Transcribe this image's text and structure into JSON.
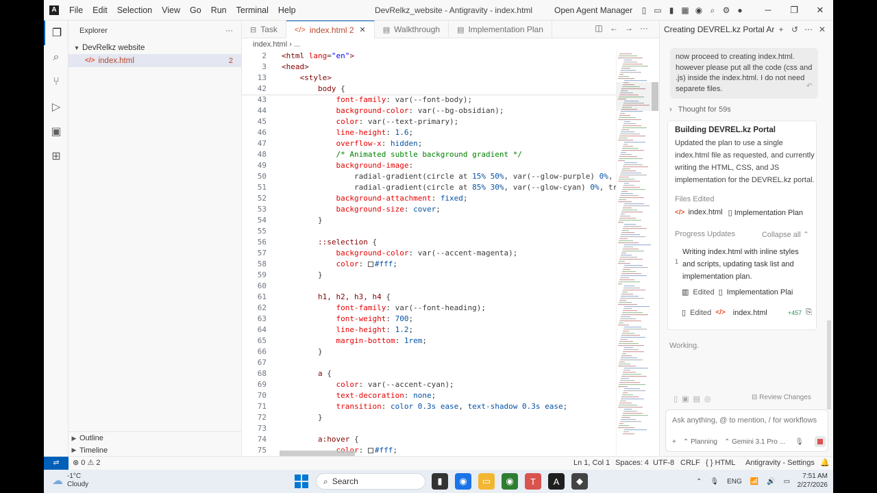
{
  "titlebar": {
    "menus": [
      "File",
      "Edit",
      "Selection",
      "View",
      "Go",
      "Run",
      "Terminal",
      "Help"
    ],
    "title": "DevRelkz_website - Antigravity - index.html",
    "agent_manager": "Open Agent Manager"
  },
  "sidebar": {
    "header": "Explorer",
    "folder": "DevRelkz website",
    "file_name": "index.html",
    "file_badge": "2",
    "outline": "Outline",
    "timeline": "Timeline"
  },
  "tabs": [
    {
      "label": "Task",
      "icon": "list-icon"
    },
    {
      "label": "index.html 2",
      "icon": "html-icon",
      "active": true
    },
    {
      "label": "Walkthrough",
      "icon": "doc-icon"
    },
    {
      "label": "Implementation Plan",
      "icon": "doc-icon"
    }
  ],
  "breadcrumb": {
    "file": "index.html",
    "rest": "..."
  },
  "editor": {
    "sticky": [
      {
        "n": "2",
        "segs": [
          [
            "c-tag",
            "<html "
          ],
          [
            "c-attr",
            "lang"
          ],
          [
            "c-txt",
            "="
          ],
          [
            "c-str",
            "\"en\""
          ],
          [
            "c-tag",
            ">"
          ]
        ]
      },
      {
        "n": "3",
        "segs": [
          [
            "c-tag",
            "<head>"
          ]
        ]
      },
      {
        "n": "13",
        "segs": [
          [
            "c-txt",
            "    "
          ],
          [
            "c-tag",
            "<style>"
          ]
        ]
      },
      {
        "n": "42",
        "segs": [
          [
            "c-txt",
            "        "
          ],
          [
            "c-sel",
            "body"
          ],
          [
            "c-txt",
            " {"
          ]
        ]
      }
    ],
    "lines": [
      {
        "n": "43",
        "segs": [
          [
            "c-txt",
            "            "
          ],
          [
            "c-prop",
            "font-family"
          ],
          [
            "c-txt",
            ": var(--font-body);"
          ]
        ]
      },
      {
        "n": "44",
        "segs": [
          [
            "c-txt",
            "            "
          ],
          [
            "c-prop",
            "background-color"
          ],
          [
            "c-txt",
            ": var(--bg-obsidian);"
          ]
        ]
      },
      {
        "n": "45",
        "segs": [
          [
            "c-txt",
            "            "
          ],
          [
            "c-prop",
            "color"
          ],
          [
            "c-txt",
            ": var(--text-primary);"
          ]
        ]
      },
      {
        "n": "46",
        "segs": [
          [
            "c-txt",
            "            "
          ],
          [
            "c-prop",
            "line-height"
          ],
          [
            "c-txt",
            ": "
          ],
          [
            "c-val",
            "1.6"
          ],
          [
            "c-txt",
            ";"
          ]
        ]
      },
      {
        "n": "47",
        "segs": [
          [
            "c-txt",
            "            "
          ],
          [
            "c-prop",
            "overflow-x"
          ],
          [
            "c-txt",
            ": "
          ],
          [
            "c-val",
            "hidden"
          ],
          [
            "c-txt",
            ";"
          ]
        ]
      },
      {
        "n": "48",
        "segs": [
          [
            "c-txt",
            "            "
          ],
          [
            "c-cmt",
            "/* Animated subtle background gradient */"
          ]
        ]
      },
      {
        "n": "49",
        "segs": [
          [
            "c-txt",
            "            "
          ],
          [
            "c-prop",
            "background-image"
          ],
          [
            "c-txt",
            ":"
          ]
        ]
      },
      {
        "n": "50",
        "segs": [
          [
            "c-txt",
            "                "
          ],
          [
            "c-txt",
            "radial-gradient(circle at "
          ],
          [
            "c-val",
            "15% 50%"
          ],
          [
            "c-txt",
            ", var(--glow-purple) "
          ],
          [
            "c-val",
            "0%"
          ],
          [
            "c-txt",
            ", t"
          ]
        ]
      },
      {
        "n": "51",
        "segs": [
          [
            "c-txt",
            "                "
          ],
          [
            "c-txt",
            "radial-gradient(circle at "
          ],
          [
            "c-val",
            "85% 30%"
          ],
          [
            "c-txt",
            ", var(--glow-cyan) "
          ],
          [
            "c-val",
            "0%"
          ],
          [
            "c-txt",
            ", tra"
          ]
        ]
      },
      {
        "n": "52",
        "segs": [
          [
            "c-txt",
            "            "
          ],
          [
            "c-prop",
            "background-attachment"
          ],
          [
            "c-txt",
            ": "
          ],
          [
            "c-val",
            "fixed"
          ],
          [
            "c-txt",
            ";"
          ]
        ]
      },
      {
        "n": "53",
        "segs": [
          [
            "c-txt",
            "            "
          ],
          [
            "c-prop",
            "background-size"
          ],
          [
            "c-txt",
            ": "
          ],
          [
            "c-val",
            "cover"
          ],
          [
            "c-txt",
            ";"
          ]
        ]
      },
      {
        "n": "54",
        "segs": [
          [
            "c-txt",
            "        }"
          ]
        ]
      },
      {
        "n": "55",
        "segs": []
      },
      {
        "n": "56",
        "segs": [
          [
            "c-txt",
            "        "
          ],
          [
            "c-sel",
            "::selection"
          ],
          [
            "c-txt",
            " {"
          ]
        ]
      },
      {
        "n": "57",
        "segs": [
          [
            "c-txt",
            "            "
          ],
          [
            "c-prop",
            "background-color"
          ],
          [
            "c-txt",
            ": var(--accent-magenta);"
          ]
        ]
      },
      {
        "n": "58",
        "segs": [
          [
            "c-txt",
            "            "
          ],
          [
            "c-prop",
            "color"
          ],
          [
            "c-txt",
            ": "
          ],
          [
            "box",
            ""
          ],
          [
            "c-val",
            "#fff"
          ],
          [
            "c-txt",
            ";"
          ]
        ]
      },
      {
        "n": "59",
        "segs": [
          [
            "c-txt",
            "        }"
          ]
        ]
      },
      {
        "n": "60",
        "segs": []
      },
      {
        "n": "61",
        "segs": [
          [
            "c-txt",
            "        "
          ],
          [
            "c-sel",
            "h1, h2, h3, h4"
          ],
          [
            "c-txt",
            " {"
          ]
        ]
      },
      {
        "n": "62",
        "segs": [
          [
            "c-txt",
            "            "
          ],
          [
            "c-prop",
            "font-family"
          ],
          [
            "c-txt",
            ": var(--font-heading);"
          ]
        ]
      },
      {
        "n": "63",
        "segs": [
          [
            "c-txt",
            "            "
          ],
          [
            "c-prop",
            "font-weight"
          ],
          [
            "c-txt",
            ": "
          ],
          [
            "c-val",
            "700"
          ],
          [
            "c-txt",
            ";"
          ]
        ]
      },
      {
        "n": "64",
        "segs": [
          [
            "c-txt",
            "            "
          ],
          [
            "c-prop",
            "line-height"
          ],
          [
            "c-txt",
            ": "
          ],
          [
            "c-val",
            "1.2"
          ],
          [
            "c-txt",
            ";"
          ]
        ]
      },
      {
        "n": "65",
        "segs": [
          [
            "c-txt",
            "            "
          ],
          [
            "c-prop",
            "margin-bottom"
          ],
          [
            "c-txt",
            ": "
          ],
          [
            "c-val",
            "1rem"
          ],
          [
            "c-txt",
            ";"
          ]
        ]
      },
      {
        "n": "66",
        "segs": [
          [
            "c-txt",
            "        }"
          ]
        ]
      },
      {
        "n": "67",
        "segs": []
      },
      {
        "n": "68",
        "segs": [
          [
            "c-txt",
            "        "
          ],
          [
            "c-sel",
            "a"
          ],
          [
            "c-txt",
            " {"
          ]
        ]
      },
      {
        "n": "69",
        "segs": [
          [
            "c-txt",
            "            "
          ],
          [
            "c-prop",
            "color"
          ],
          [
            "c-txt",
            ": var(--accent-cyan);"
          ]
        ]
      },
      {
        "n": "70",
        "segs": [
          [
            "c-txt",
            "            "
          ],
          [
            "c-prop",
            "text-decoration"
          ],
          [
            "c-txt",
            ": "
          ],
          [
            "c-val",
            "none"
          ],
          [
            "c-txt",
            ";"
          ]
        ]
      },
      {
        "n": "71",
        "segs": [
          [
            "c-txt",
            "            "
          ],
          [
            "c-prop",
            "transition"
          ],
          [
            "c-txt",
            ": "
          ],
          [
            "c-val",
            "color 0.3s ease"
          ],
          [
            "c-txt",
            ", "
          ],
          [
            "c-val",
            "text-shadow 0.3s ease"
          ],
          [
            "c-txt",
            ";"
          ]
        ]
      },
      {
        "n": "72",
        "segs": [
          [
            "c-txt",
            "        }"
          ]
        ]
      },
      {
        "n": "73",
        "segs": []
      },
      {
        "n": "74",
        "segs": [
          [
            "c-txt",
            "        "
          ],
          [
            "c-sel",
            "a:hover"
          ],
          [
            "c-txt",
            " {"
          ]
        ]
      },
      {
        "n": "75",
        "segs": [
          [
            "c-txt",
            "            "
          ],
          [
            "c-prop",
            "color"
          ],
          [
            "c-txt",
            ": "
          ],
          [
            "box",
            ""
          ],
          [
            "c-val",
            "#fff"
          ],
          [
            "c-txt",
            ";"
          ]
        ]
      }
    ]
  },
  "agent": {
    "title": "Creating DEVREL.kz Portal Artifa",
    "user_message": "now proceed to creating index.html. however please put all the code (css and .js) inside the index.html. I do not need separete files.",
    "thought": "Thought for 59s",
    "task_title": "Building DEVREL.kz Portal",
    "task_desc": "Updated the plan to use a single index.html file as requested, and currently writing the HTML, CSS, and JS implementation for the DEVREL.kz portal.",
    "files_edited_label": "Files Edited",
    "files_edited": [
      "index.html",
      "Implementation Plan"
    ],
    "progress_label": "Progress Updates",
    "collapse_all": "Collapse all",
    "progress_num": "1",
    "progress_text": "Writing index.html with inline styles and scripts, updating task list and implementation plan.",
    "edited_label": "Edited",
    "edited_plan": "Implementation Plai",
    "edited_file": "index.html",
    "edited_plus": "+457",
    "working": "Working.",
    "review_changes": "Review Changes",
    "input_placeholder": "Ask anything, @ to mention, / for workflows",
    "mode": "Planning",
    "model": "Gemini 3.1 Pro ..."
  },
  "statusbar": {
    "errors": "0",
    "warnings": "2",
    "position": "Ln 1, Col 1",
    "spaces": "Spaces: 4",
    "encoding": "UTF-8",
    "eol": "CRLF",
    "language": "HTML",
    "settings": "Antigravity - Settings"
  },
  "taskbar": {
    "temp": "-1°C",
    "weather": "Cloudy",
    "search": "Search",
    "lang": "ENG",
    "time": "7:51 AM",
    "date": "2/27/2026"
  },
  "colors": {
    "accent": "#005fb8",
    "html_icon": "#e44d26",
    "stop": "#d9534f"
  }
}
